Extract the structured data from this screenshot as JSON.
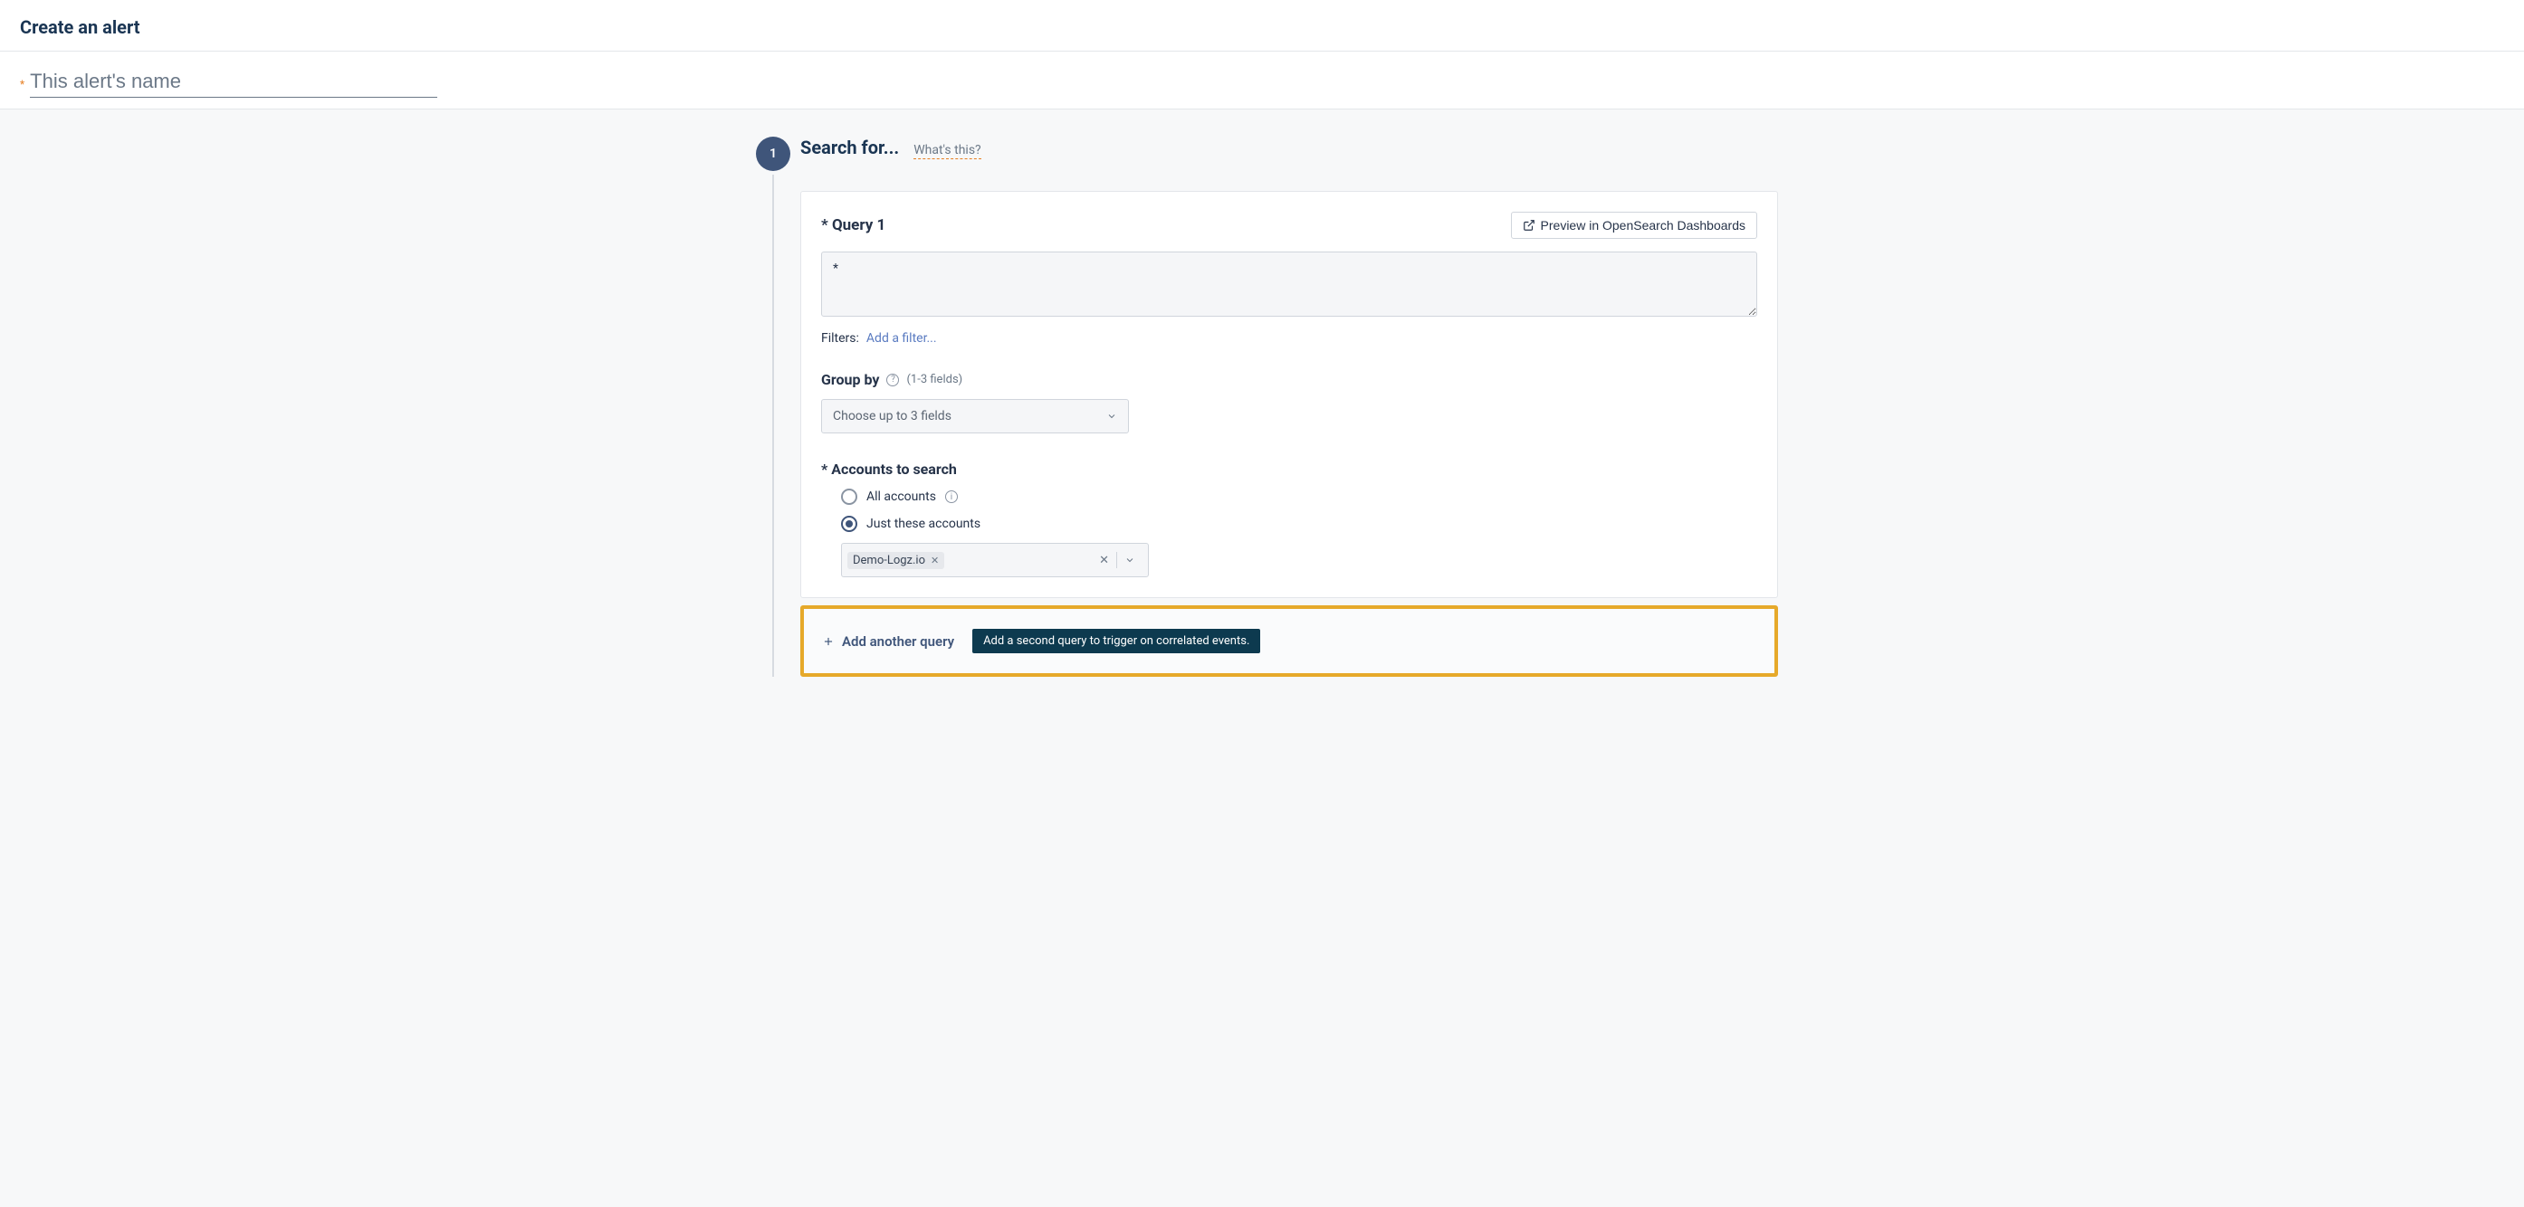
{
  "header": {
    "title": "Create an alert"
  },
  "alertName": {
    "placeholder": "This alert's name",
    "value": ""
  },
  "step1": {
    "badge": "1",
    "heading": "Search for...",
    "whatsThis": "What's this?"
  },
  "query": {
    "label": "* Query 1",
    "previewLabel": "Preview in OpenSearch Dashboards",
    "queryValue": "*",
    "filtersLabel": "Filters:",
    "addFilter": "Add a filter..."
  },
  "groupBy": {
    "label": "Group by",
    "hint": "(1-3 fields)",
    "placeholder": "Choose up to 3 fields"
  },
  "accounts": {
    "label": "* Accounts to search",
    "optionAll": "All accounts",
    "optionJust": "Just these accounts",
    "chip": "Demo-Logz.io"
  },
  "addQuery": {
    "button": "Add another query",
    "tooltip": "Add a second query to trigger on correlated events."
  }
}
